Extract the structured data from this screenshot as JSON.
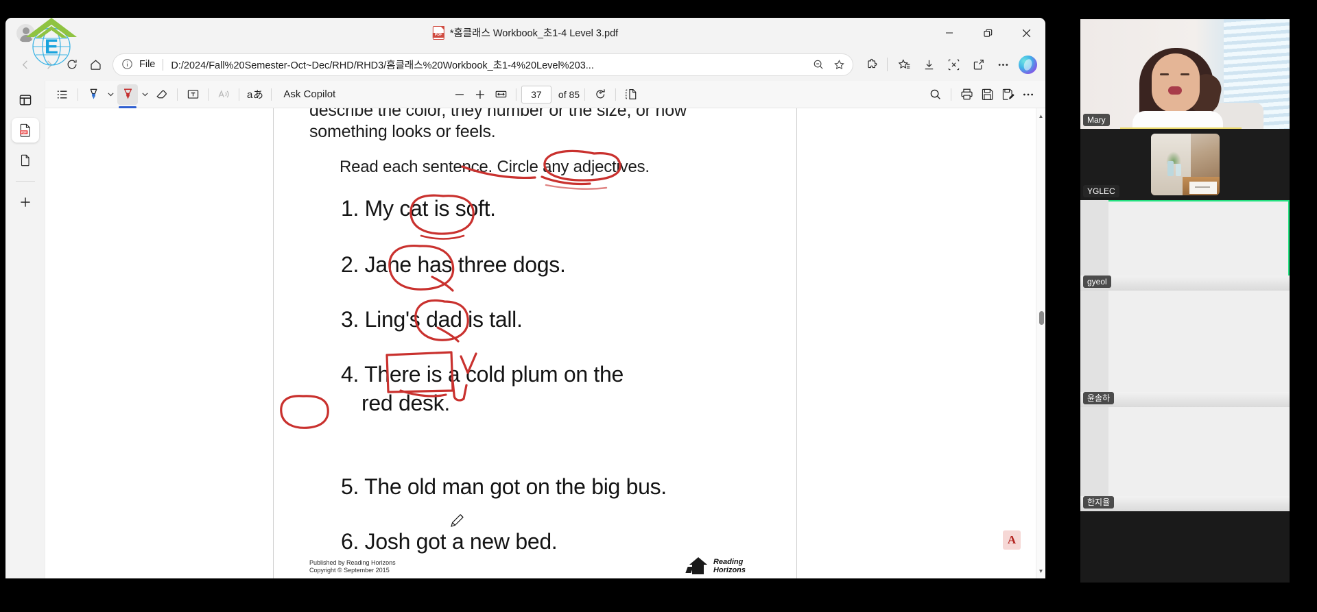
{
  "window": {
    "tab_title": "*홈클래스 Workbook_초1-4 Level 3.pdf",
    "minimize_label": "Minimize",
    "restore_label": "Restore",
    "close_label": "Close"
  },
  "navbar": {
    "back_label": "Back",
    "forward_label": "Forward",
    "refresh_label": "Refresh",
    "home_label": "Home",
    "file_label": "File",
    "url": "D:/2024/Fall%20Semester-Oct~Dec/RHD/RHD3/홈클래스%20Workbook_초1-4%20Level%203...",
    "zoom_out_label": "Zoom out",
    "favorite_label": "Add to favorites",
    "extensions_label": "Extensions",
    "collections_label": "Collections",
    "downloads_label": "Downloads",
    "screenshot_label": "Screenshot",
    "share_label": "Share",
    "more_label": "Settings and more",
    "copilot_label": "Copilot"
  },
  "tabstrip": {
    "items": [
      {
        "name": "split-screen",
        "label": "Split screen"
      },
      {
        "name": "pdf-tab",
        "label": "홈클래스 Workbook_초1-4 Level 3.pdf",
        "active": true
      },
      {
        "name": "blank-page-tab",
        "label": "New page"
      }
    ],
    "add_label": "Add tab"
  },
  "pdf_toolbar": {
    "contents_label": "Table of contents",
    "highlight_label": "Highlight",
    "highlight_color": "#1f6fd0",
    "draw_label": "Draw",
    "draw_color": "#cc2f2f",
    "draw_active": true,
    "erase_label": "Erase",
    "text_label": "Add text",
    "read_aloud_label": "Read aloud",
    "translate_label": "Translate",
    "ask_copilot_label": "Ask Copilot",
    "zoom_out_label": "Zoom out",
    "zoom_in_label": "Zoom in",
    "fit_page_label": "Fit to page",
    "current_page": "37",
    "page_total": "of 85",
    "rotate_label": "Rotate",
    "page_view_label": "Page view",
    "search_label": "Find",
    "print_label": "Print",
    "save_label": "Save",
    "save_as_label": "Save as",
    "more_label": "More options",
    "accent_color": "#2f5fd0"
  },
  "document": {
    "lead_line_1": "describe the color, they number or the size, or how",
    "lead_line_2": "something looks or feels.",
    "instruction": "Read each sentence. Circle any adjectives.",
    "questions": [
      "1. My cat is soft.",
      "2. Jane has three dogs.",
      "3. Ling's dad is tall.",
      "4. There is a cold plum on the",
      "5. The old man got on the big bus.",
      "6. Josh got a new bed."
    ],
    "question_4_line_2": "red desk.",
    "footer_publisher": "Published by Reading Horizons",
    "footer_copyright": "Copyright © September 2015",
    "footer_logo_line1": "Reading",
    "footer_logo_line2": "Horizons",
    "adobe_badge": "A",
    "annotation_color": "#c9312e"
  },
  "video_panel": {
    "tiles": [
      {
        "name": "Mary",
        "active": false
      },
      {
        "name": "YGLEC",
        "active": false
      },
      {
        "name": "gyeol",
        "active": true
      },
      {
        "name": "윤솔하",
        "active": false
      },
      {
        "name": "한지율",
        "active": false
      }
    ],
    "active_border_color": "#22e07f"
  }
}
